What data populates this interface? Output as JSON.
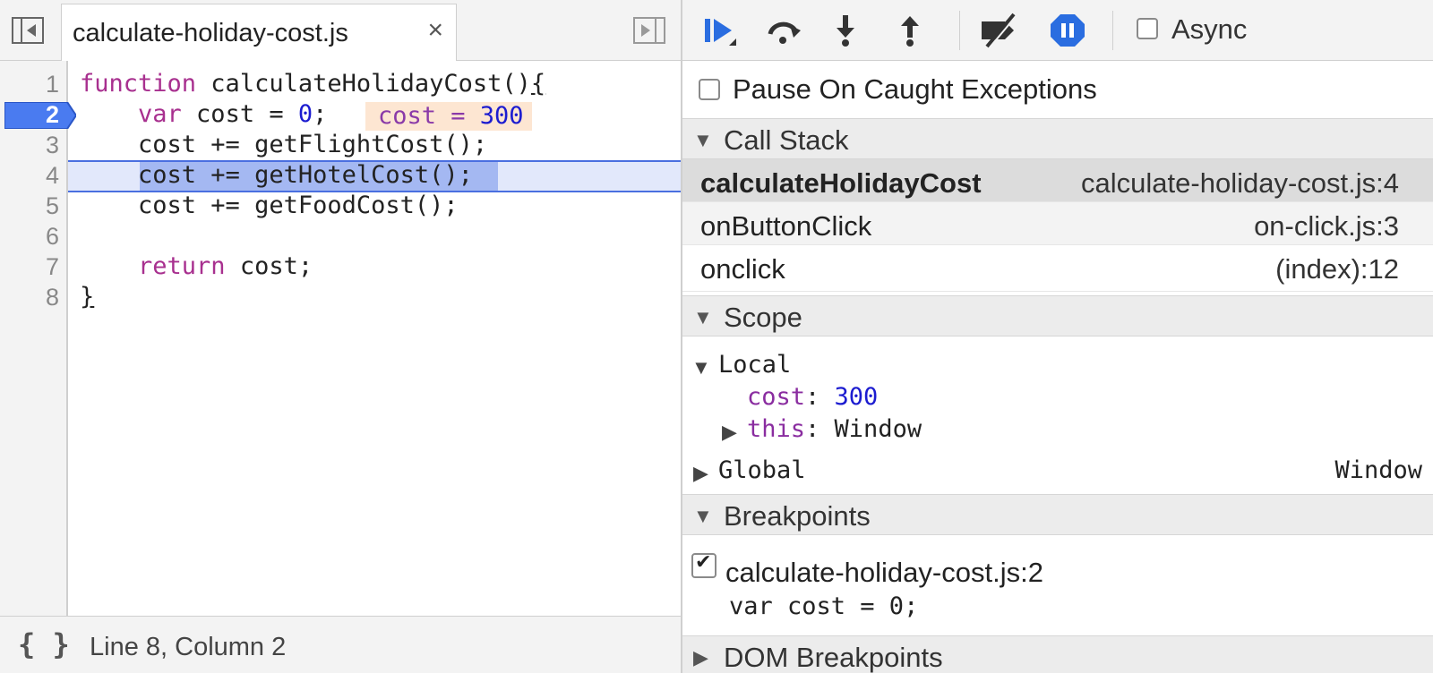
{
  "editor": {
    "tab_title": "calculate-holiday-cost.js",
    "tab_close": "×",
    "line_numbers": [
      "1",
      "2",
      "3",
      "4",
      "5",
      "6",
      "7",
      "8"
    ],
    "active_line": "2",
    "inline_value_name": "cost = ",
    "inline_value_num": "300",
    "lines": {
      "l1_kw": "function",
      "l1_name": " calculateHolidayCost()",
      "l1_brace": "{",
      "l2_kw": "    var",
      "l2_a": " cost = ",
      "l2_num": "0",
      "l2_b": ";",
      "l3": "    cost += getFlightCost();",
      "l4_indent": "    ",
      "l4": "cost += getHotelCost();",
      "l5": "    cost += getFoodCost();",
      "l7_kw": "    return",
      "l7_rest": " cost;",
      "l8": "}"
    }
  },
  "status": {
    "pretty_print": "{ }",
    "position": "Line 8, Column 2"
  },
  "toolbar": {
    "async_label": "Async"
  },
  "pause": {
    "label": "Pause On Caught Exceptions"
  },
  "call_stack": {
    "title": "Call Stack",
    "frames": [
      {
        "fn": "calculateHolidayCost",
        "loc": "calculate-holiday-cost.js:4"
      },
      {
        "fn": "onButtonClick",
        "loc": "on-click.js:3"
      },
      {
        "fn": "onclick",
        "loc": "(index):12"
      }
    ]
  },
  "scope": {
    "title": "Scope",
    "local_label": "Local",
    "cost_key": "cost",
    "cost_sep": ": ",
    "cost_val": "300",
    "this_key": "this",
    "this_sep": ": ",
    "this_val": "Window",
    "global_label": "Global",
    "global_val": "Window"
  },
  "breakpoints": {
    "title": "Breakpoints",
    "item_label": "calculate-holiday-cost.js:2",
    "item_code": "var cost = 0;"
  },
  "dom_breakpoints": {
    "title": "DOM Breakpoints"
  },
  "colors": {
    "accent": "#4a6fe0",
    "keyword": "#a8308f",
    "number": "#1c1cd0",
    "inline_value_bg": "#fde6d2"
  }
}
